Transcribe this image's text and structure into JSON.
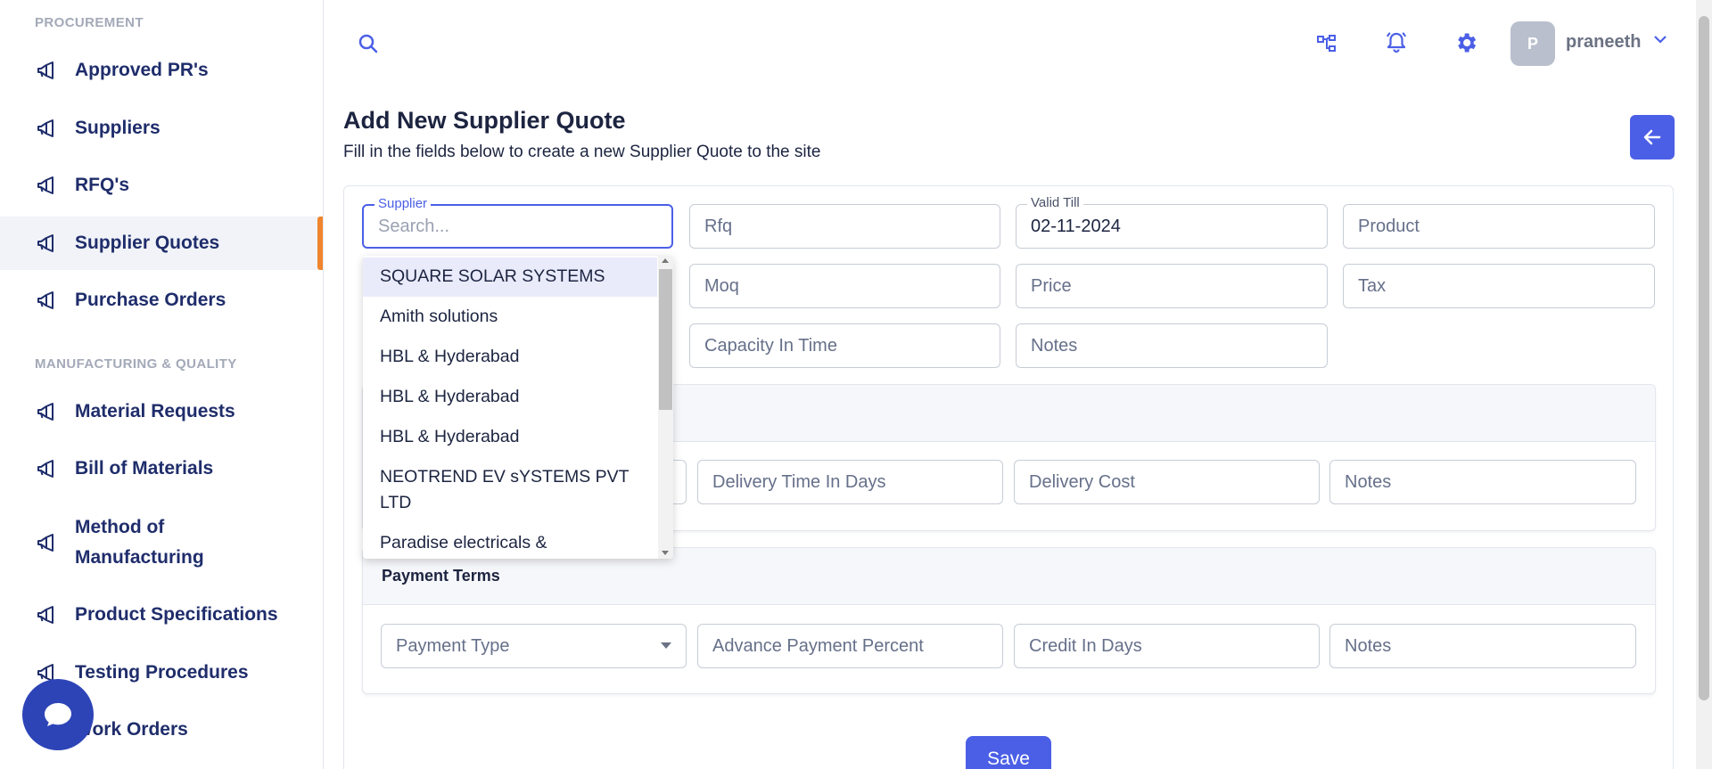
{
  "sidebar": {
    "sections": [
      {
        "title": "PROCUREMENT",
        "items": [
          "Approved PR's",
          "Suppliers",
          "RFQ's",
          "Supplier Quotes",
          "Purchase Orders"
        ]
      },
      {
        "title": "MANUFACTURING & QUALITY",
        "items": [
          "Material Requests",
          "Bill of Materials",
          "Method of Manufacturing",
          "Product Specifications",
          "Testing Procedures",
          "Work Orders"
        ]
      }
    ],
    "active_item": "Supplier Quotes",
    "item_icon": "megaphone-icon"
  },
  "topbar": {
    "avatar_initial": "P",
    "username": "praneeth",
    "icons": [
      "search-icon",
      "hierarchy-icon",
      "bell-icon",
      "gear-icon",
      "chevron-down-icon"
    ]
  },
  "header": {
    "title": "Add New Supplier Quote",
    "subtitle": "Fill in the fields below to create a new Supplier Quote to the site"
  },
  "form": {
    "supplier": {
      "label": "Supplier",
      "placeholder": "Search..."
    },
    "rfq": {
      "placeholder": "Rfq"
    },
    "valid_till": {
      "label": "Valid Till",
      "value": "02-11-2024"
    },
    "product": {
      "placeholder": "Product"
    },
    "moq": {
      "placeholder": "Moq"
    },
    "price": {
      "placeholder": "Price"
    },
    "tax": {
      "placeholder": "Tax"
    },
    "capacity": {
      "placeholder": "Capacity In Time"
    },
    "notes": {
      "placeholder": "Notes"
    }
  },
  "delivery": {
    "fields": [
      "Delivery Time In Days",
      "Delivery Cost",
      "Notes"
    ]
  },
  "payment": {
    "title": "Payment Terms",
    "payment_type": "Payment Type",
    "fields": [
      "Advance Payment Percent",
      "Credit In Days",
      "Notes"
    ]
  },
  "dropdown": {
    "options": [
      "SQUARE SOLAR SYSTEMS",
      "Amith solutions",
      "HBL & Hyderabad",
      "HBL & Hyderabad",
      "HBL & Hyderabad",
      "NEOTREND EV sYSTEMS PVT LTD",
      "Paradise electricals &"
    ]
  },
  "save_label": "Save",
  "colors": {
    "accent": "#4b5fe6",
    "active_marker": "#f0852d",
    "nav_text": "#1f2d6b"
  }
}
